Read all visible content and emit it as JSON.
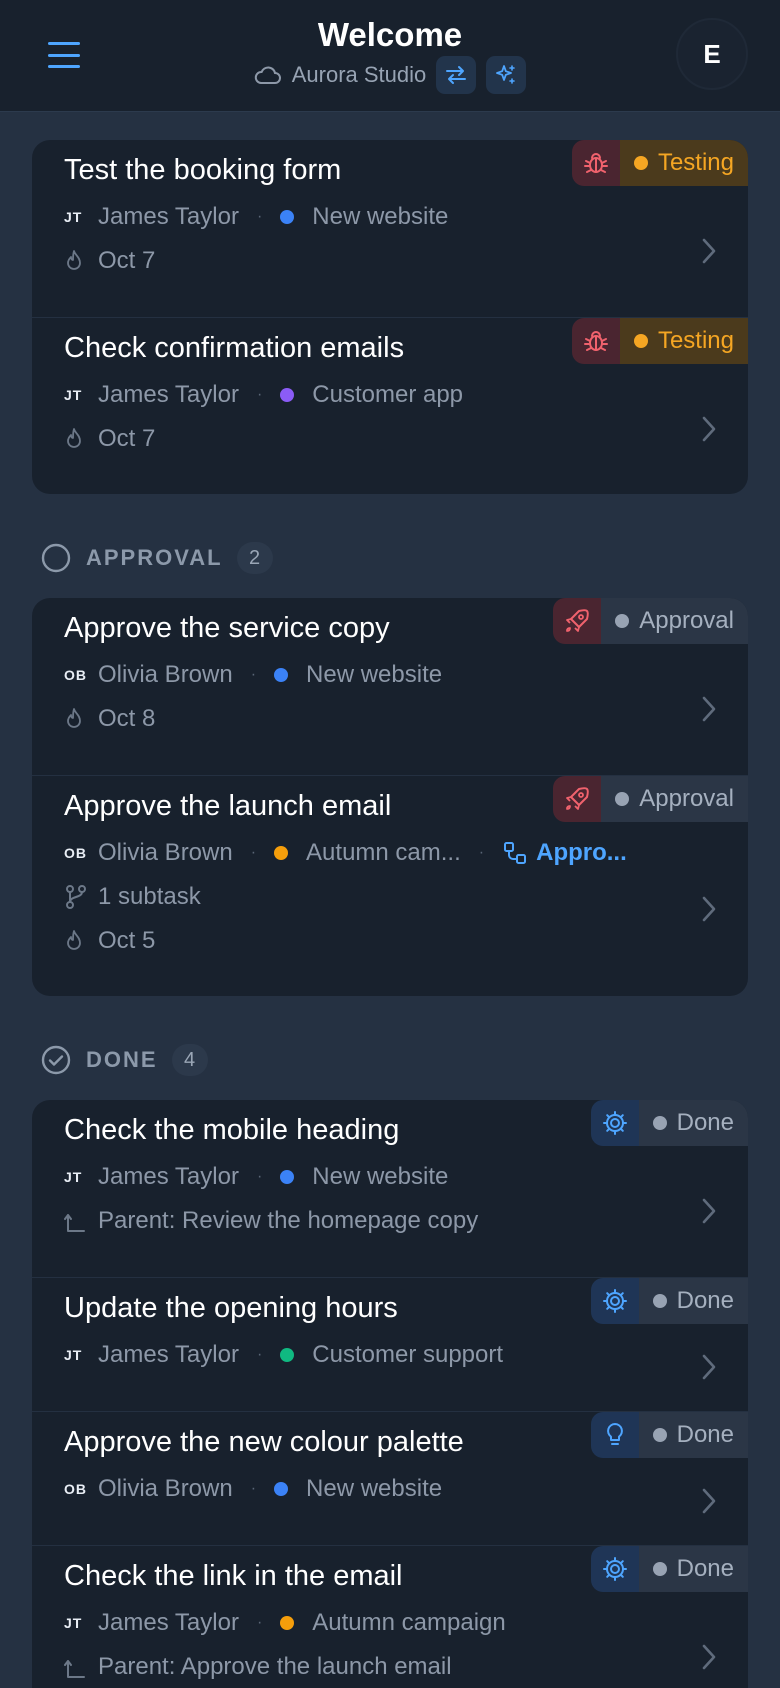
{
  "header": {
    "title": "Welcome",
    "workspace": "Aurora Studio",
    "avatar_initial": "E"
  },
  "colors": {
    "accent": "#4ea5ff",
    "testing": "#f5a623",
    "bug": "#f0626d",
    "project_new_website": "#3b82f6",
    "project_customer_app": "#8b5cf6",
    "project_autumn_campaign": "#f59e0b",
    "project_customer_support": "#10b981"
  },
  "sections": {
    "testing": {
      "rows": [
        {
          "title": "Test the booking form",
          "initials": "JT",
          "assignee": "James Taylor",
          "project": "New website",
          "date": "Oct 7",
          "status": "Testing",
          "status_icon": "bug-icon"
        },
        {
          "title": "Check confirmation emails",
          "initials": "JT",
          "assignee": "James Taylor",
          "project": "Customer app",
          "date": "Oct 7",
          "status": "Testing",
          "status_icon": "bug-icon"
        }
      ]
    },
    "approval": {
      "label": "APPROVAL",
      "count": "2",
      "rows": [
        {
          "title": "Approve the service copy",
          "initials": "OB",
          "assignee": "Olivia Brown",
          "project": "New website",
          "date": "Oct 8",
          "status": "Approval",
          "status_icon": "rocket-icon"
        },
        {
          "title": "Approve the launch email",
          "initials": "OB",
          "assignee": "Olivia Brown",
          "project": "Autumn cam...",
          "link": "Appro...",
          "subtasks": "1 subtask",
          "date": "Oct 5",
          "status": "Approval",
          "status_icon": "rocket-icon"
        }
      ]
    },
    "done": {
      "label": "DONE",
      "count": "4",
      "rows": [
        {
          "title": "Check the mobile heading",
          "initials": "JT",
          "assignee": "James Taylor",
          "project": "New website",
          "parent": "Parent: Review the homepage copy",
          "status": "Done",
          "status_icon": "gear-icon"
        },
        {
          "title": "Update the opening hours",
          "initials": "JT",
          "assignee": "James Taylor",
          "project": "Customer support",
          "status": "Done",
          "status_icon": "gear-icon"
        },
        {
          "title": "Approve the new colour palette",
          "initials": "OB",
          "assignee": "Olivia Brown",
          "project": "New website",
          "status": "Done",
          "status_icon": "lightbulb-icon"
        },
        {
          "title": "Check the link in the email",
          "initials": "JT",
          "assignee": "James Taylor",
          "project": "Autumn campaign",
          "parent": "Parent: Approve the launch email",
          "status": "Done",
          "status_icon": "gear-icon"
        }
      ]
    }
  }
}
